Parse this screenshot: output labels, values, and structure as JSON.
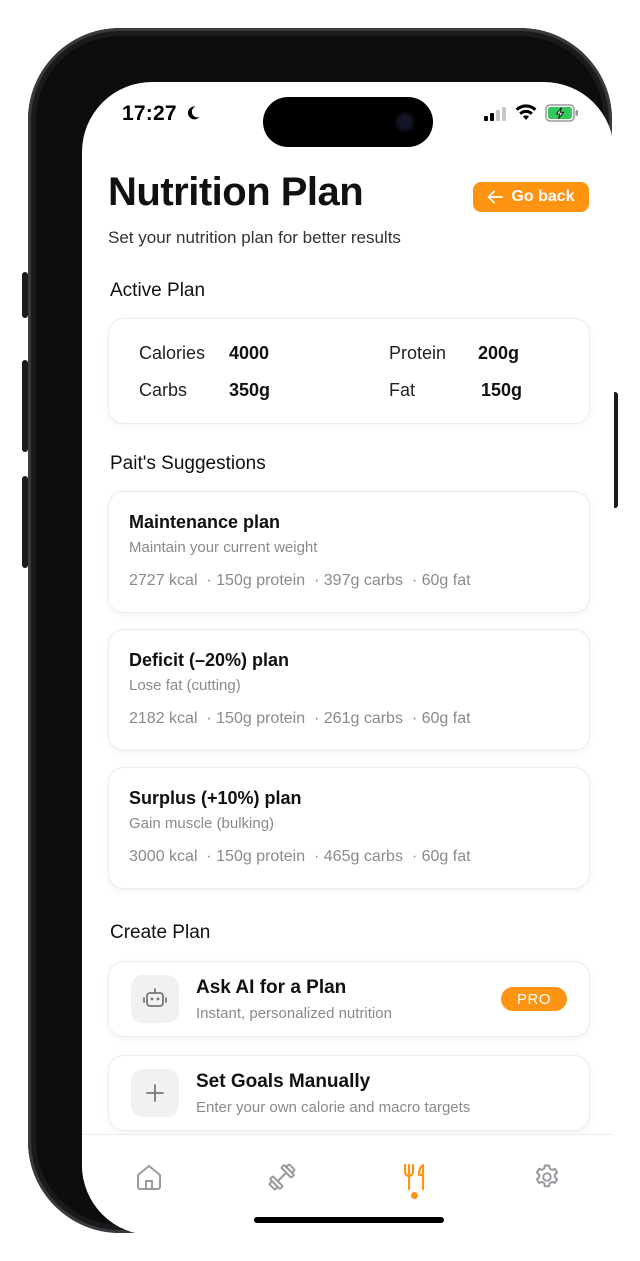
{
  "status_bar": {
    "time": "17:27"
  },
  "header": {
    "title": "Nutrition Plan",
    "subtitle": "Set your nutrition plan for better results",
    "go_back_label": "Go back"
  },
  "active_plan": {
    "heading": "Active Plan",
    "calories_label": "Calories",
    "calories_value": "4000",
    "protein_label": "Protein",
    "protein_value": "200g",
    "carbs_label": "Carbs",
    "carbs_value": "350g",
    "fat_label": "Fat",
    "fat_value": "150g"
  },
  "suggestions": {
    "heading": "Pait's Suggestions",
    "items": [
      {
        "title": "Maintenance plan",
        "desc": "Maintain your current weight",
        "stats": "2727 kcal  · 150g protein  · 397g carbs  · 60g fat"
      },
      {
        "title": "Deficit (–20%) plan",
        "desc": "Lose fat (cutting)",
        "stats": "2182 kcal  · 150g protein  · 261g carbs  · 60g fat"
      },
      {
        "title": "Surplus (+10%) plan",
        "desc": "Gain muscle (bulking)",
        "stats": "3000 kcal  · 150g protein  · 465g carbs  · 60g fat"
      }
    ]
  },
  "create_plan": {
    "heading": "Create Plan",
    "ai": {
      "title": "Ask AI for a Plan",
      "desc": "Instant, personalized nutrition",
      "badge": "PRO",
      "icon": "robot-icon"
    },
    "manual": {
      "title": "Set Goals Manually",
      "desc": "Enter your own calorie and macro targets",
      "icon": "plus-icon"
    }
  },
  "tabbar": {
    "items": [
      "home-icon",
      "dumbbell-icon",
      "fork-knife-icon",
      "gear-icon"
    ],
    "active": "fork-knife-icon"
  },
  "colors": {
    "accent": "#ff9412",
    "muted": "#8a8a8e",
    "active_tab": "#ff9412",
    "inactive_tab": "#9a9aa0"
  }
}
